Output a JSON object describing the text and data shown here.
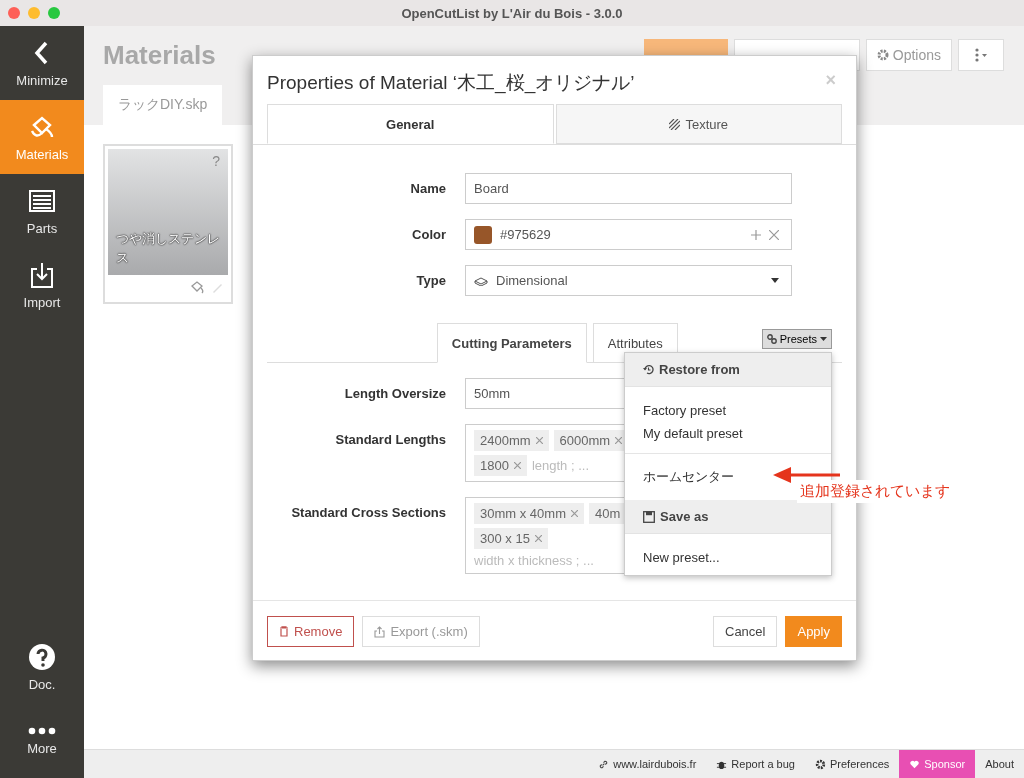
{
  "window": {
    "title": "OpenCutList by L'Air du Bois - 3.0.0"
  },
  "sidebar": {
    "items": [
      {
        "kind": "minimize",
        "label": "Minimize",
        "selected": false
      },
      {
        "kind": "materials",
        "label": "Materials",
        "selected": true
      },
      {
        "kind": "parts",
        "label": "Parts",
        "selected": false
      },
      {
        "kind": "import",
        "label": "Import",
        "selected": false
      }
    ],
    "bottom_items": [
      {
        "kind": "doc",
        "label": "Doc.",
        "selected": false
      },
      {
        "kind": "more",
        "label": "More",
        "selected": false
      }
    ]
  },
  "page": {
    "title": "Materials",
    "header_buttons": [
      {
        "kind": "primary"
      },
      {
        "kind": "plain"
      },
      {
        "kind": "options",
        "label": "Options"
      },
      {
        "kind": "menu"
      }
    ],
    "file_tabs": [
      {
        "label": "ラックDIY.skp",
        "selected": true
      }
    ],
    "materials": [
      {
        "name": "つや消しステンレス",
        "badge": "?"
      }
    ]
  },
  "dialog": {
    "title": "Properties of Material ‘木工_桜_オリジナル’",
    "close": "×",
    "tabs": [
      {
        "label": "General",
        "selected": true,
        "kind": "general"
      },
      {
        "label": "Texture",
        "selected": false,
        "kind": "texture"
      }
    ],
    "fields": [
      {
        "kind": "text",
        "label": "Name",
        "value": "Board"
      },
      {
        "kind": "color",
        "label": "Color",
        "value": "#975629",
        "color": "#975629"
      },
      {
        "kind": "select",
        "label": "Type",
        "value": "Dimensional"
      }
    ],
    "subtabs": [
      {
        "label": "Cutting Parameters",
        "selected": true
      },
      {
        "label": "Attributes",
        "selected": false
      }
    ],
    "presets_button": "Presets",
    "params": [
      {
        "kind": "text",
        "label": "Length Oversize",
        "value": "50mm"
      },
      {
        "kind": "tags",
        "label": "Standard Lengths",
        "tag_lines": [
          [
            "2400mm",
            "6000mm"
          ],
          [
            "1800"
          ]
        ],
        "placeholder": "length ; ..."
      },
      {
        "kind": "tags",
        "label": "Standard Cross Sections",
        "tag_lines": [
          [
            "30mm x 40mm",
            {
              "label": "40m",
              "cut": true
            }
          ],
          [
            "300 x 15"
          ]
        ],
        "placeholder": "width x thickness ; ..."
      }
    ],
    "buttons": [
      {
        "kind": "remove",
        "label": "Remove"
      },
      {
        "kind": "export",
        "label": "Export (.skm)"
      },
      {
        "kind": "cancel",
        "label": "Cancel"
      },
      {
        "kind": "apply",
        "label": "Apply"
      }
    ]
  },
  "presets_menu": [
    {
      "kind": "restore",
      "label": "Restore from"
    },
    {
      "kind": "item",
      "label": "Factory preset"
    },
    {
      "kind": "item",
      "label": "My default preset"
    },
    {
      "kind": "divider"
    },
    {
      "kind": "item",
      "label": "ホームセンター"
    },
    {
      "kind": "save",
      "label": "Save as"
    },
    {
      "kind": "item",
      "label": "New preset..."
    }
  ],
  "annotation": {
    "text": "追加登録されています"
  },
  "footer": [
    {
      "kind": "link",
      "label": "www.lairdubois.fr"
    },
    {
      "kind": "bug",
      "label": "Report a bug"
    },
    {
      "kind": "gear",
      "label": "Preferences"
    },
    {
      "kind": "sponsor",
      "label": "Sponsor"
    },
    {
      "kind": "plain",
      "label": "About"
    }
  ]
}
